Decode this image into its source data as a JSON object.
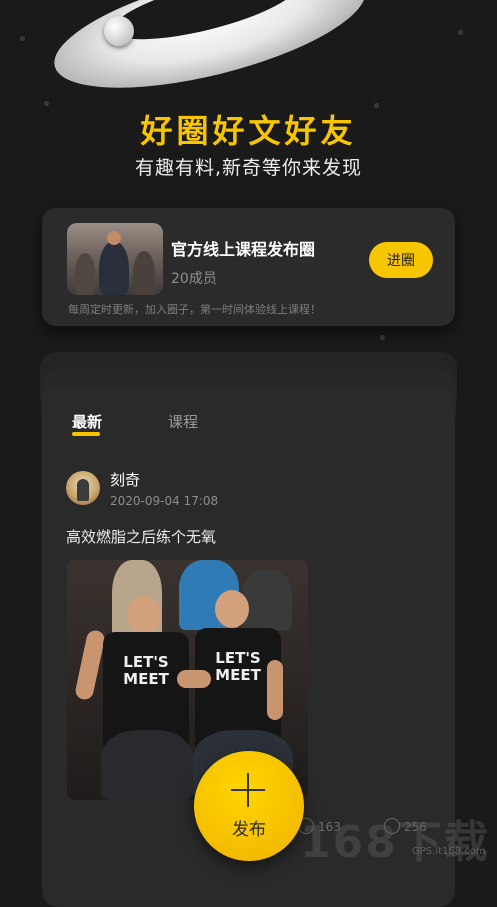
{
  "hero": {
    "title": "好圈好文好友",
    "subtitle": "有趣有料,新奇等你来发现"
  },
  "circle": {
    "name": "官方线上课程发布圈",
    "members": "20成员",
    "join_label": "进圈",
    "description": "每周定时更新，加入圈子，第一时间体验线上课程！"
  },
  "tabs": [
    {
      "label": "最新",
      "active": true
    },
    {
      "label": "课程",
      "active": false
    }
  ],
  "post": {
    "author": "刻奇",
    "time": "2020-09-04 17:08",
    "text": "高效燃脂之后练个无氧",
    "shirt_text": "LET'S MEET",
    "comments": "163",
    "likes": "256"
  },
  "fab": {
    "label": "发布"
  },
  "watermark": {
    "text": "168下载",
    "sub": "GPS.it168.com"
  },
  "colors": {
    "accent": "#f7c600",
    "background": "#1a1a1a",
    "card": "#2a2a2a"
  }
}
